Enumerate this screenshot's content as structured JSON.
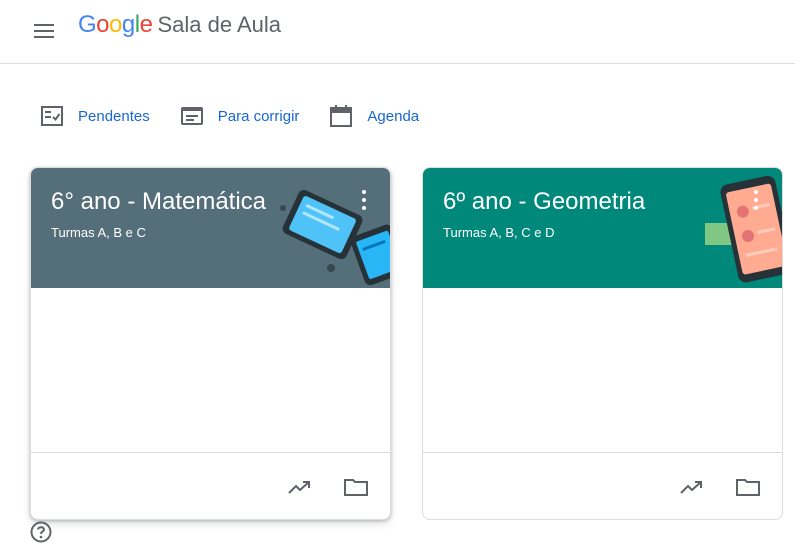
{
  "header": {
    "logo_google": "Google",
    "logo_product": "Sala de Aula",
    "menu_icon": "hamburger-menu-icon"
  },
  "nav": [
    {
      "label": "Pendentes",
      "icon": "todo-checklist-icon"
    },
    {
      "label": "Para corrigir",
      "icon": "to-review-icon"
    },
    {
      "label": "Agenda",
      "icon": "calendar-icon"
    }
  ],
  "courses": [
    {
      "title": "6° ano - Matemática",
      "subtitle": "Turmas A, B e C",
      "banner_color": "#546e7a",
      "menu_icon": "more-vert-icon"
    },
    {
      "title": "6º ano - Geometria",
      "subtitle": "Turmas A, B, C e D",
      "banner_color": "#00897b",
      "menu_icon": "more-vert-icon"
    }
  ],
  "card_actions": [
    "trending-up-icon",
    "folder-icon"
  ],
  "help_icon": "help-icon",
  "colors": {
    "accent": "#1967d2",
    "google_blue": "#4285f4",
    "google_red": "#ea4335",
    "google_yellow": "#fbbc05",
    "google_green": "#34a853"
  }
}
